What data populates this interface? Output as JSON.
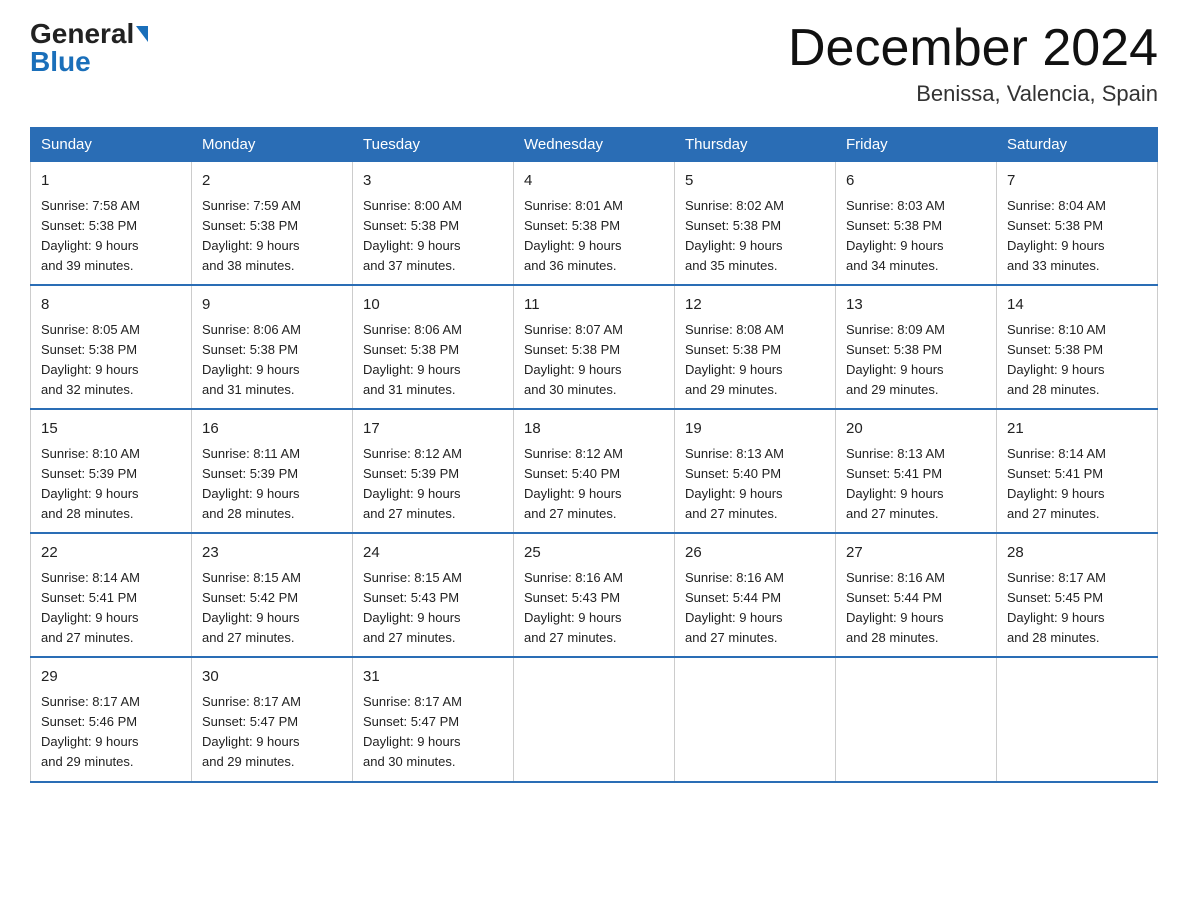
{
  "header": {
    "logo_general": "General",
    "logo_blue": "Blue",
    "month_title": "December 2024",
    "location": "Benissa, Valencia, Spain"
  },
  "days_of_week": [
    "Sunday",
    "Monday",
    "Tuesday",
    "Wednesday",
    "Thursday",
    "Friday",
    "Saturday"
  ],
  "weeks": [
    [
      {
        "day": "1",
        "sunrise": "7:58 AM",
        "sunset": "5:38 PM",
        "daylight": "9 hours and 39 minutes."
      },
      {
        "day": "2",
        "sunrise": "7:59 AM",
        "sunset": "5:38 PM",
        "daylight": "9 hours and 38 minutes."
      },
      {
        "day": "3",
        "sunrise": "8:00 AM",
        "sunset": "5:38 PM",
        "daylight": "9 hours and 37 minutes."
      },
      {
        "day": "4",
        "sunrise": "8:01 AM",
        "sunset": "5:38 PM",
        "daylight": "9 hours and 36 minutes."
      },
      {
        "day": "5",
        "sunrise": "8:02 AM",
        "sunset": "5:38 PM",
        "daylight": "9 hours and 35 minutes."
      },
      {
        "day": "6",
        "sunrise": "8:03 AM",
        "sunset": "5:38 PM",
        "daylight": "9 hours and 34 minutes."
      },
      {
        "day": "7",
        "sunrise": "8:04 AM",
        "sunset": "5:38 PM",
        "daylight": "9 hours and 33 minutes."
      }
    ],
    [
      {
        "day": "8",
        "sunrise": "8:05 AM",
        "sunset": "5:38 PM",
        "daylight": "9 hours and 32 minutes."
      },
      {
        "day": "9",
        "sunrise": "8:06 AM",
        "sunset": "5:38 PM",
        "daylight": "9 hours and 31 minutes."
      },
      {
        "day": "10",
        "sunrise": "8:06 AM",
        "sunset": "5:38 PM",
        "daylight": "9 hours and 31 minutes."
      },
      {
        "day": "11",
        "sunrise": "8:07 AM",
        "sunset": "5:38 PM",
        "daylight": "9 hours and 30 minutes."
      },
      {
        "day": "12",
        "sunrise": "8:08 AM",
        "sunset": "5:38 PM",
        "daylight": "9 hours and 29 minutes."
      },
      {
        "day": "13",
        "sunrise": "8:09 AM",
        "sunset": "5:38 PM",
        "daylight": "9 hours and 29 minutes."
      },
      {
        "day": "14",
        "sunrise": "8:10 AM",
        "sunset": "5:38 PM",
        "daylight": "9 hours and 28 minutes."
      }
    ],
    [
      {
        "day": "15",
        "sunrise": "8:10 AM",
        "sunset": "5:39 PM",
        "daylight": "9 hours and 28 minutes."
      },
      {
        "day": "16",
        "sunrise": "8:11 AM",
        "sunset": "5:39 PM",
        "daylight": "9 hours and 28 minutes."
      },
      {
        "day": "17",
        "sunrise": "8:12 AM",
        "sunset": "5:39 PM",
        "daylight": "9 hours and 27 minutes."
      },
      {
        "day": "18",
        "sunrise": "8:12 AM",
        "sunset": "5:40 PM",
        "daylight": "9 hours and 27 minutes."
      },
      {
        "day": "19",
        "sunrise": "8:13 AM",
        "sunset": "5:40 PM",
        "daylight": "9 hours and 27 minutes."
      },
      {
        "day": "20",
        "sunrise": "8:13 AM",
        "sunset": "5:41 PM",
        "daylight": "9 hours and 27 minutes."
      },
      {
        "day": "21",
        "sunrise": "8:14 AM",
        "sunset": "5:41 PM",
        "daylight": "9 hours and 27 minutes."
      }
    ],
    [
      {
        "day": "22",
        "sunrise": "8:14 AM",
        "sunset": "5:41 PM",
        "daylight": "9 hours and 27 minutes."
      },
      {
        "day": "23",
        "sunrise": "8:15 AM",
        "sunset": "5:42 PM",
        "daylight": "9 hours and 27 minutes."
      },
      {
        "day": "24",
        "sunrise": "8:15 AM",
        "sunset": "5:43 PM",
        "daylight": "9 hours and 27 minutes."
      },
      {
        "day": "25",
        "sunrise": "8:16 AM",
        "sunset": "5:43 PM",
        "daylight": "9 hours and 27 minutes."
      },
      {
        "day": "26",
        "sunrise": "8:16 AM",
        "sunset": "5:44 PM",
        "daylight": "9 hours and 27 minutes."
      },
      {
        "day": "27",
        "sunrise": "8:16 AM",
        "sunset": "5:44 PM",
        "daylight": "9 hours and 28 minutes."
      },
      {
        "day": "28",
        "sunrise": "8:17 AM",
        "sunset": "5:45 PM",
        "daylight": "9 hours and 28 minutes."
      }
    ],
    [
      {
        "day": "29",
        "sunrise": "8:17 AM",
        "sunset": "5:46 PM",
        "daylight": "9 hours and 29 minutes."
      },
      {
        "day": "30",
        "sunrise": "8:17 AM",
        "sunset": "5:47 PM",
        "daylight": "9 hours and 29 minutes."
      },
      {
        "day": "31",
        "sunrise": "8:17 AM",
        "sunset": "5:47 PM",
        "daylight": "9 hours and 30 minutes."
      },
      null,
      null,
      null,
      null
    ]
  ],
  "labels": {
    "sunrise": "Sunrise:",
    "sunset": "Sunset:",
    "daylight": "Daylight:"
  }
}
